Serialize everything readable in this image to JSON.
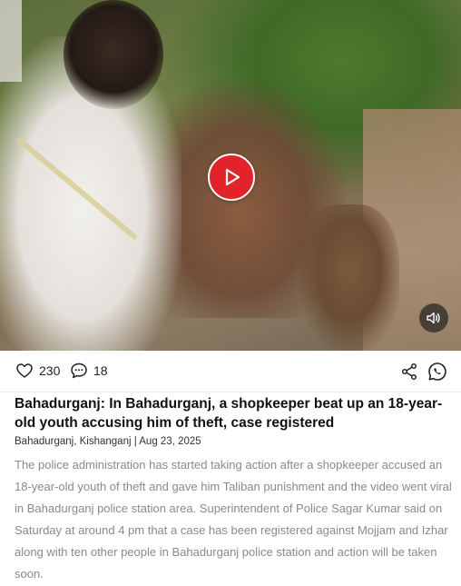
{
  "video": {
    "play_icon": "play-icon",
    "mute_icon": "speaker-icon"
  },
  "actions": {
    "like_count": "230",
    "comment_count": "18",
    "like_icon": "heart-icon",
    "comment_icon": "comment-bubble-icon",
    "share_icon": "share-icon",
    "whatsapp_icon": "whatsapp-icon"
  },
  "article": {
    "headline": "Bahadurganj: In Bahadurganj, a shopkeeper beat up an 18-year-old youth accusing him of theft, case registered",
    "byline": "Bahadurganj, Kishanganj | Aug 23, 2025",
    "summary": "The police administration has started taking action after a shopkeeper accused an 18-year-old youth of theft and gave him Taliban punishment and the video went viral in Bahadurganj police station area. Superintendent of Police Sagar Kumar said on Saturday at around 4 pm that a case has been registered against Mojjam and Izhar along with ten other people in Bahadurganj police station and action will be taken soon."
  },
  "colors": {
    "play_button": "#e0242a",
    "summary_text": "#8a8a8a",
    "headline_text": "#111111"
  }
}
